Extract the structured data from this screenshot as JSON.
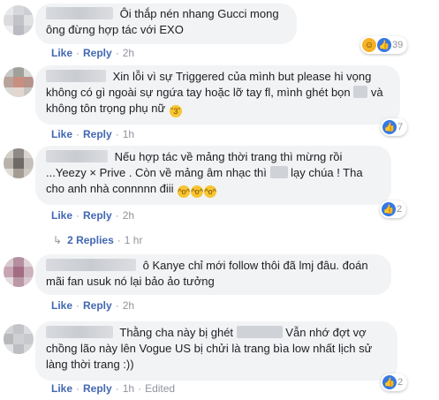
{
  "comments": [
    {
      "text": "Ôi thắp nén nhang Gucci mong ông đừng hợp tác với EXO",
      "like": "Like",
      "reply": "Reply",
      "time": "2h",
      "reaction_count": "39",
      "reaction_icons": [
        "haha-icon",
        "like-icon"
      ],
      "avatar_colors": [
        "#e8e9ec",
        "#d6d7db",
        "#ccced3",
        "#dcdcdf",
        "#c2c3c8",
        "#e1e1e4",
        "#efeff1",
        "#b9bbc1",
        "#d2d3d7"
      ]
    },
    {
      "text_a": "Xin lỗi vì sự Triggered của mình but please hi vọng không có gì ngoài sự ngứa tay hoặc lỡ tay fl, mình ghét bọn",
      "text_b": "và không tôn trọng phụ nữ",
      "like": "Like",
      "reply": "Reply",
      "time": "1h",
      "reaction_count": "7",
      "reaction_icons": [
        "like-icon"
      ],
      "avatar_colors": [
        "#c7c9c6",
        "#9ea29b",
        "#d8d8d4",
        "#b7a39a",
        "#c88f80",
        "#b5928a",
        "#d9d9d5",
        "#e3d6d0",
        "#c7c7c2"
      ]
    },
    {
      "text_a": "Nếu hợp tác về mảng thời trang thì mừng rồi ...Yeezy × Prive . Còn về mảng âm nhạc thì",
      "text_b": "lạy chúa ! Tha cho anh nhà connnnn điii",
      "like": "Like",
      "reply": "Reply",
      "time": "2h",
      "reaction_count": "2",
      "reaction_icons": [
        "like-icon"
      ],
      "replies_label": "2 Replies",
      "replies_time": "1 hr",
      "avatar_colors": [
        "#d3cfc8",
        "#8f8a86",
        "#d9d6cf",
        "#b8b2ab",
        "#6f6a66",
        "#c5c0b9",
        "#e0ddd8",
        "#a39d96",
        "#cfcac3"
      ]
    },
    {
      "text": "ô Kanye chỉ mới follow thôi đã lmj đâu. đoán mãi fan usuk nó lại bảo ảo tưởng",
      "like": "Like",
      "reply": "Reply",
      "time": "2h",
      "avatar_colors": [
        "#d7c9cf",
        "#b58fa0",
        "#e0d3d8",
        "#c7a5b3",
        "#a26d83",
        "#cdb3be",
        "#e5dde1",
        "#bb98a6",
        "#d9c8cf"
      ]
    },
    {
      "text_a": "Thằng cha này bị ghét",
      "text_b": "Vẫn nhớ đợt vợ chồng lão này lên Vogue US bị chửi là trang bìa low nhất lịch sử làng thời trang :))",
      "like": "Like",
      "reply": "Reply",
      "time": "1h",
      "edited": "Edited",
      "reaction_count": "2",
      "reaction_icons": [
        "like-icon"
      ],
      "avatar_colors": [
        "#d2d3d5",
        "#c3c4c7",
        "#dcdddf",
        "#b8b9bc",
        "#cfd0d2",
        "#c8c9cc",
        "#e1e2e4",
        "#bdbec1",
        "#d6d7d9"
      ]
    }
  ],
  "reply_arrow": "↳"
}
